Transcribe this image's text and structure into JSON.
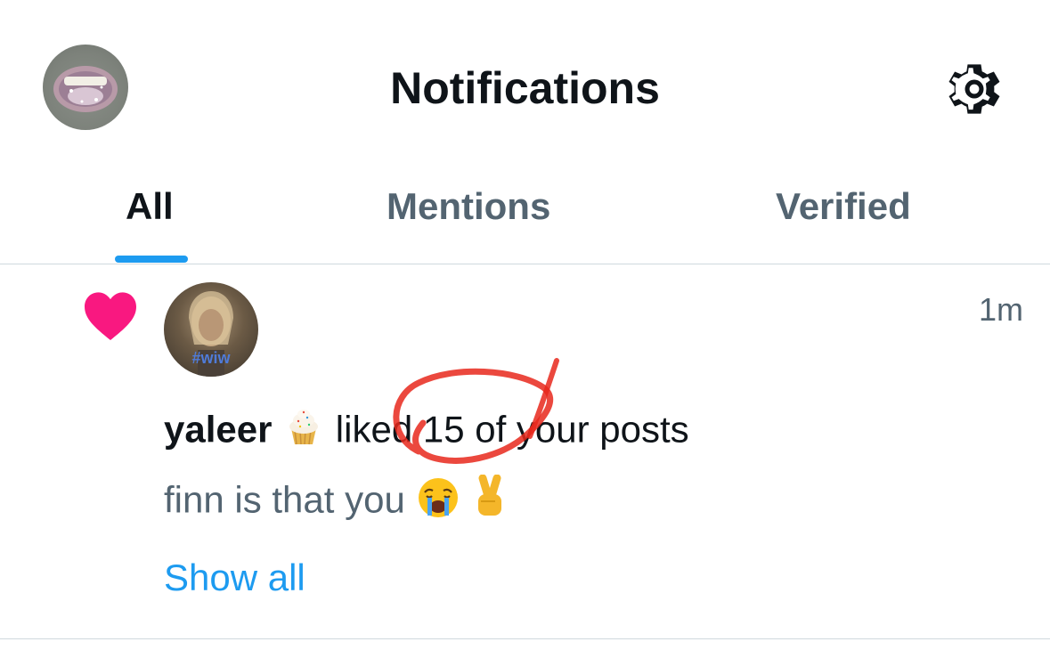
{
  "header": {
    "title": "Notifications",
    "avatar_icon": "avatar-self",
    "settings_icon": "gear-icon"
  },
  "tabs": [
    {
      "label": "All",
      "active": true
    },
    {
      "label": "Mentions",
      "active": false
    },
    {
      "label": "Verified",
      "active": false
    }
  ],
  "notification": {
    "type_icon": "heart-icon",
    "time": "1m",
    "avatar_tag": "#wiw",
    "username": "yaleer",
    "username_emoji": "cupcake",
    "action_text": "liked 15 of your posts",
    "post_text": "finn is that you",
    "post_emojis": [
      "crying-face",
      "victory-hand"
    ],
    "show_all_label": "Show all"
  },
  "colors": {
    "accent": "#1d9bf0",
    "heart": "#f91880",
    "text_primary": "#0f1419",
    "text_secondary": "#536471",
    "divider": "#cfd9de",
    "annotation": "#e8281c"
  }
}
